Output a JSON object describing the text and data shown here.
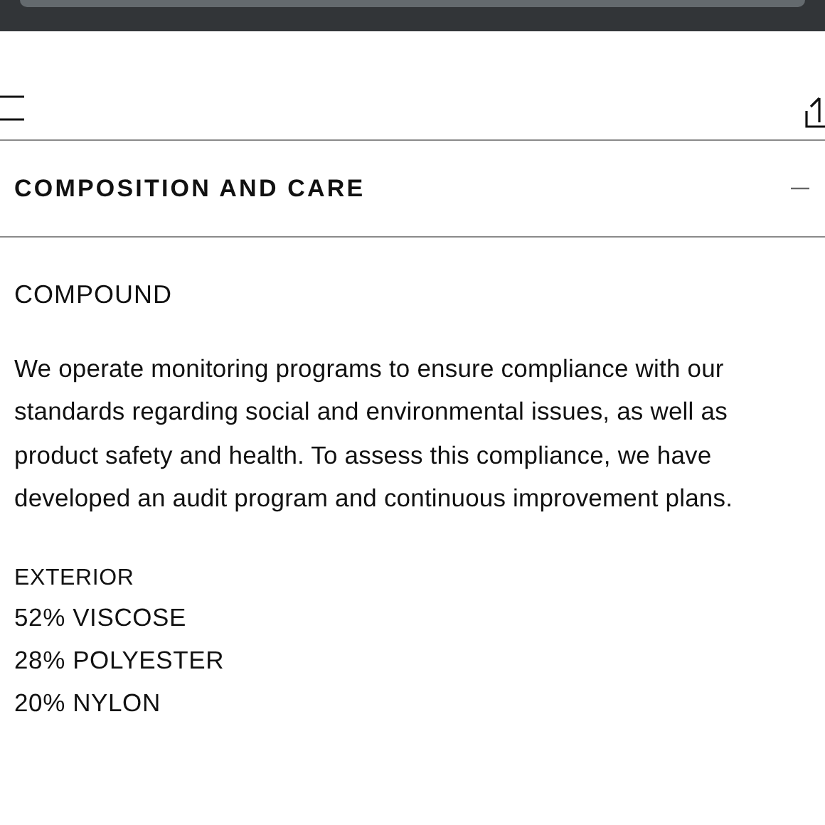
{
  "section": {
    "title": "COMPOSITION AND CARE",
    "expanded": true
  },
  "compound": {
    "heading": "COMPOUND",
    "description": "We operate monitoring programs to ensure compliance with our standards regarding social and environmental issues, as well as product safety and health. To assess this compliance, we have developed an audit program and continuous improvement plans."
  },
  "exterior": {
    "heading": "EXTERIOR",
    "materials": [
      "52% VISCOSE",
      "28% POLYESTER",
      "20% NYLON"
    ]
  }
}
